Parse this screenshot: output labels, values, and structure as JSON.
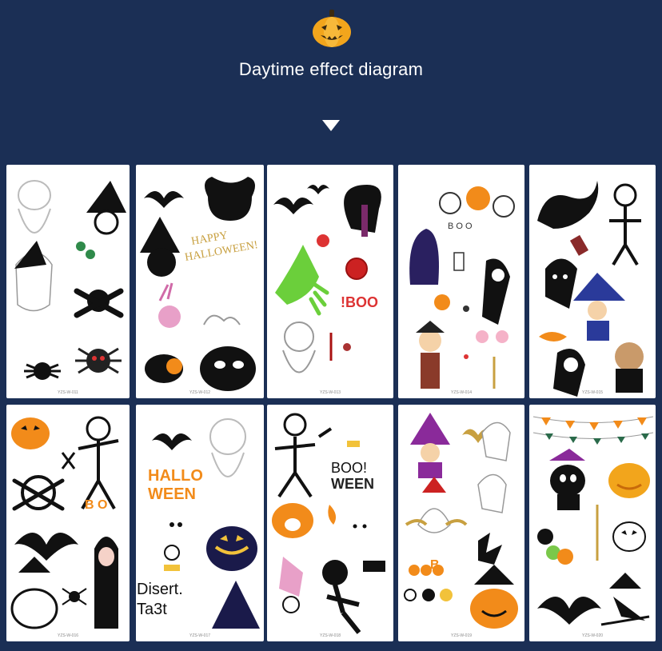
{
  "banner": {
    "headline": "Daytime effect diagram",
    "background": "#1b2f55",
    "logo_icon": "pumpkin-icon",
    "arrow_icon": "down-arrow-icon"
  },
  "sheets": [
    {
      "code": "YZS-W-011",
      "labels": []
    },
    {
      "code": "YZS-W-012",
      "labels": [
        "HAPPY",
        "HALLOWEEN!"
      ]
    },
    {
      "code": "YZS-W-013",
      "labels": [
        "!BOO"
      ]
    },
    {
      "code": "YZS-W-014",
      "labels": [
        "B O O"
      ]
    },
    {
      "code": "YZS-W-015",
      "labels": []
    },
    {
      "code": "YZS-W-016",
      "labels": [
        "B O"
      ]
    },
    {
      "code": "YZS-W-017",
      "labels": [
        "HALLO",
        "WEEN"
      ]
    },
    {
      "code": "YZS-W-018",
      "labels": [
        "BOO!",
        "WEEN"
      ]
    },
    {
      "code": "YZS-W-019",
      "labels": [
        "B"
      ]
    },
    {
      "code": "YZS-W-020",
      "labels": []
    }
  ],
  "overlays": {
    "line1": "Disert.",
    "line2": "Ta3t"
  }
}
